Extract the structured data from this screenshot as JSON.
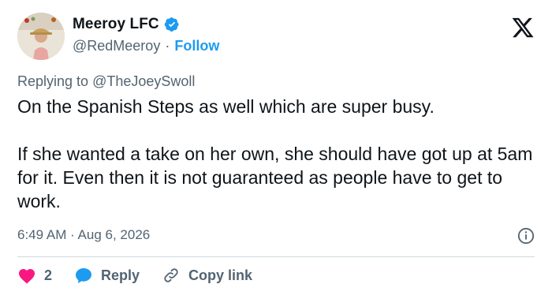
{
  "author": {
    "name": "Meeroy LFC",
    "handle": "@RedMeeroy",
    "separator": "·",
    "follow_label": "Follow"
  },
  "reply_context": {
    "prefix": "Replying to",
    "mention": "@TheJoeySwoll"
  },
  "tweet": {
    "paragraph_1": "On the Spanish Steps as well which are super busy.",
    "paragraph_2": "If she wanted a take on her own, she should have got up at 5am for it. Even then it is not guaranteed as people have to get to work."
  },
  "timestamp": "6:49 AM · Aug 6, 2026",
  "actions": {
    "like_count": "2",
    "reply_label": "Reply",
    "copy_label": "Copy link"
  },
  "colors": {
    "accent": "#1d9bf0",
    "like": "#f91880",
    "muted": "#536471",
    "text": "#0f1419"
  },
  "icons": [
    "verified-badge-icon",
    "x-logo-icon",
    "info-icon",
    "heart-icon",
    "reply-bubble-icon",
    "link-icon"
  ]
}
